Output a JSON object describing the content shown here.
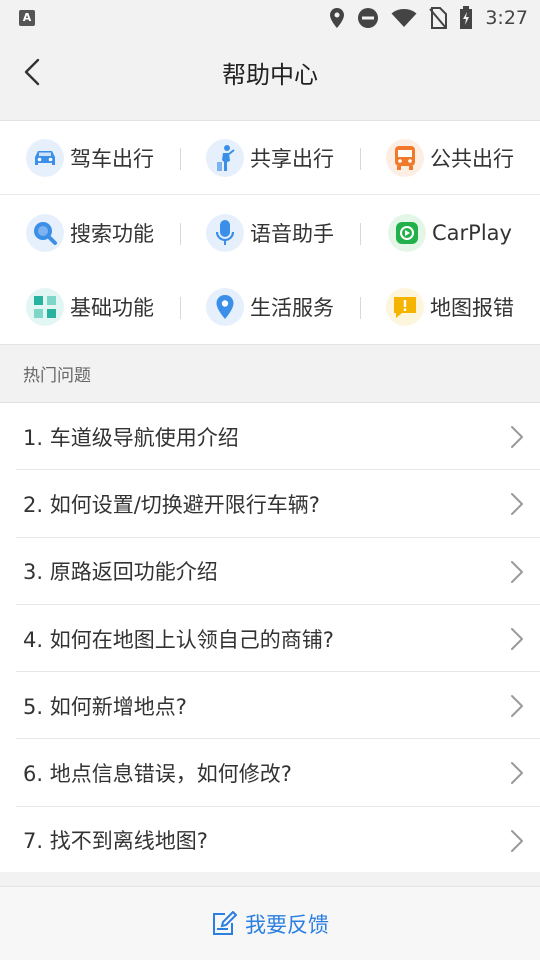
{
  "status_bar": {
    "left_badge": "A",
    "time": "3:27"
  },
  "nav": {
    "title": "帮助中心"
  },
  "categories": [
    {
      "label": "驾车出行",
      "icon": "car-icon",
      "color": "#3b8fe8"
    },
    {
      "label": "共享出行",
      "icon": "walking-person-icon",
      "color": "#3b8fe8"
    },
    {
      "label": "公共出行",
      "icon": "bus-icon",
      "color": "#f07a2a"
    },
    {
      "label": "搜索功能",
      "icon": "search-icon",
      "color": "#3b8fe8"
    },
    {
      "label": "语音助手",
      "icon": "microphone-icon",
      "color": "#3b8fe8"
    },
    {
      "label": "CarPlay",
      "icon": "carplay-icon",
      "color": "#22b04b"
    },
    {
      "label": "基础功能",
      "icon": "grid-blocks-icon",
      "color": "#27b3a0"
    },
    {
      "label": "生活服务",
      "icon": "location-pin-icon",
      "color": "#3b8fe8"
    },
    {
      "label": "地图报错",
      "icon": "warning-icon",
      "color": "#f5b400"
    }
  ],
  "faq": {
    "header": "热门问题",
    "items": [
      "1. 车道级导航使用介绍",
      "2. 如何设置/切换避开限行车辆?",
      "3. 原路返回功能介绍",
      "4. 如何在地图上认领自己的商铺?",
      "5. 如何新增地点?",
      "6. 地点信息错误，如何修改?",
      "7. 找不到离线地图?"
    ]
  },
  "feedback": {
    "label": "我要反馈",
    "icon": "edit-note-icon",
    "color": "#2b7fe0"
  }
}
